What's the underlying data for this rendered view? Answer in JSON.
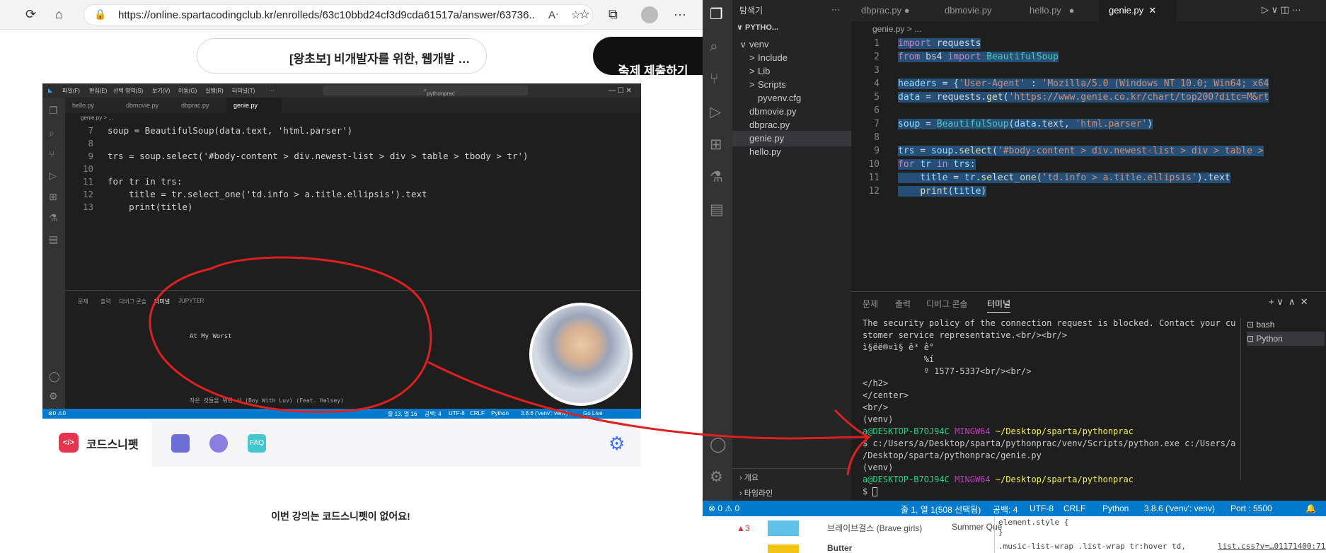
{
  "browser": {
    "url": "https://online.spartacodingclub.kr/enrolleds/63c10bbd24cf3d9cda61517a/answer/63736..."
  },
  "page": {
    "course_title": "[왕초보] 비개발자를 위한, 웹개발 종합반",
    "submit_label": "숙제 제출하기",
    "submit_arrow": ">"
  },
  "video": {
    "menu": [
      "파일(F)",
      "편집(E)",
      "선택 영역(S)",
      "보기(V)",
      "이동(G)",
      "실행(R)",
      "터미널(T)",
      "···"
    ],
    "search": "pythonprac",
    "tabs": [
      "hello.py",
      "dbmovie.py",
      "dbprac.py",
      "genie.py"
    ],
    "breadcrumb": "genie.py > ...",
    "code": [
      {
        "n": "7",
        "t": "soup = BeautifulSoup(data.text, 'html.parser')"
      },
      {
        "n": "8",
        "t": ""
      },
      {
        "n": "9",
        "t": "trs = soup.select('#body-content > div.newest-list > div > table > tbody > tr')"
      },
      {
        "n": "10",
        "t": ""
      },
      {
        "n": "11",
        "t": "for tr in trs:"
      },
      {
        "n": "12",
        "t": "    title = tr.select_one('td.info > a.title.ellipsis').text"
      },
      {
        "n": "13",
        "t": "    print(title)"
      }
    ],
    "panel_tabs": [
      "문제",
      "출력",
      "디버그 콘솔",
      "터미널",
      "JUPYTER"
    ],
    "output_line": "At My Worst",
    "output_bottom": "작은 것들을 위한 시 (Boy With Luv) (Feat. Halsey)",
    "status_left": "⊗0 ⚠0",
    "status_items": [
      "줄 13, 열 16",
      "공백: 4",
      "UTF-8",
      "CRLF",
      "Python",
      "3.8.6 ('venv': venv)",
      "Go Live"
    ]
  },
  "snippet": {
    "tab_label": "코드스니펫",
    "logo": "</>",
    "faq": "FAQ",
    "message": "이번 강의는 코드스니펫이 없어요!"
  },
  "vscode": {
    "explorer_title": "탐색기",
    "project": "PYTHO...",
    "tree": [
      {
        "label": "venv",
        "indent": 0,
        "arrow": "v"
      },
      {
        "label": "Include",
        "indent": 1,
        "arrow": ">"
      },
      {
        "label": "Lib",
        "indent": 1,
        "arrow": ">"
      },
      {
        "label": "Scripts",
        "indent": 1,
        "arrow": ">"
      },
      {
        "label": "pyvenv.cfg",
        "indent": 1,
        "arrow": ""
      },
      {
        "label": "dbmovie.py",
        "indent": 0,
        "arrow": ""
      },
      {
        "label": "dbprac.py",
        "indent": 0,
        "arrow": ""
      },
      {
        "label": "genie.py",
        "indent": 0,
        "arrow": "",
        "selected": true
      },
      {
        "label": "hello.py",
        "indent": 0,
        "arrow": ""
      }
    ],
    "tabs": [
      "dbprac.py",
      "dbmovie.py",
      "hello.py",
      "genie.py"
    ],
    "breadcrumb": "genie.py > ...",
    "code_lines": [
      "1",
      "2",
      "3",
      "4",
      "5",
      "6",
      "7",
      "8",
      "9",
      "10",
      "11",
      "12"
    ],
    "panel_tabs": [
      "문제",
      "출력",
      "디버그 콘솔",
      "터미널"
    ],
    "terminal": [
      "The security policy of the connection request is blocked. Contact your cu",
      "stomer service representative.<br/><br/>",
      "ì§ëë®¤ì§ ê³ ê°",
      "            %í",
      "            º 1577-5337<br/><br/>",
      "</h2>",
      "</center>",
      "<br/>",
      "(venv)"
    ],
    "prompt_user": "a@DESKTOP-B7OJ94C",
    "prompt_shell": "MINGW64",
    "prompt_path": "~/Desktop/sparta/pythonprac",
    "command": "$ c:/Users/a/Desktop/sparta/pythonprac/venv/Scripts/python.exe c:/Users/a",
    "command2": "/Desktop/sparta/pythonprac/genie.py",
    "venv": "(venv)",
    "prompt_end": "$ ",
    "shells": [
      "bash",
      "Python"
    ],
    "outline": [
      "개요",
      "타임라인"
    ],
    "status": [
      "⊗ 0 ⚠ 0",
      "줄 1, 열 1(508 선택됨)",
      "공백: 4",
      "UTF-8",
      "CRLF",
      "Python",
      "3.8.6 ('venv': venv)",
      "Port : 5500"
    ],
    "devtools": {
      "artist": "브레이브걸스 (Brave girls)",
      "song": "Summer Que",
      "rank_change": "▲3",
      "style1": "element.style {",
      "style2": "}",
      "rule": ".music-list-wrap .list-wrap tr:hover td,",
      "rule_src": "list.css?v=…01171400:71",
      "next_song": "Butter"
    }
  }
}
